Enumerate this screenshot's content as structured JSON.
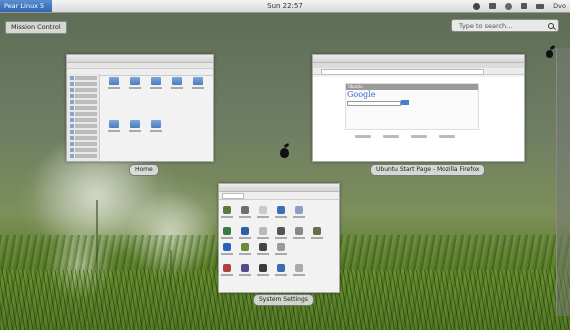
{
  "top_panel": {
    "brand": "Pear Linux 5",
    "clock": "Sun 22:57",
    "user": "Dvo"
  },
  "mission_control": {
    "label": "Mission Control",
    "search_placeholder": "Type to search..."
  },
  "windows": [
    {
      "caption": "Home"
    },
    {
      "caption": "Ubuntu Start Page - Mozilla Firefox"
    },
    {
      "caption": "System Settings"
    }
  ],
  "firefox": {
    "box_title": "Ubuntu",
    "search_logo": "Google"
  },
  "icons": [
    "power-icon",
    "mail-icon",
    "network-icon",
    "volume-icon",
    "battery-icon",
    "search-icon",
    "pear-icon"
  ]
}
